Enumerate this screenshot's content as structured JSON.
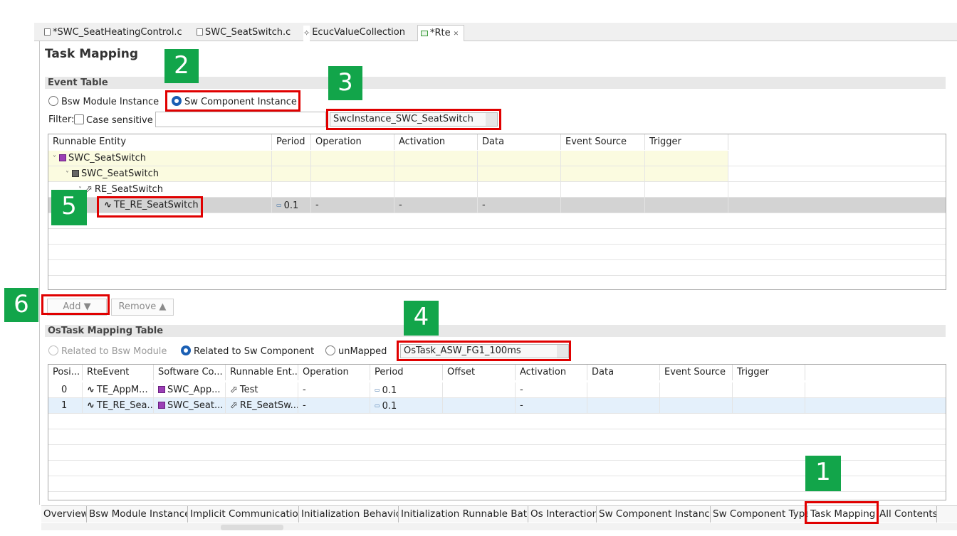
{
  "editor_tabs": [
    {
      "label": "*SWC_SeatHeatingControl.c",
      "icon": "c-file-icon"
    },
    {
      "label": "SWC_SeatSwitch.c",
      "icon": "c-file-icon"
    },
    {
      "label": "EcucValueCollection",
      "icon": "ecuc-icon"
    },
    {
      "label": "*Rte",
      "icon": "rte-icon",
      "close": "✕"
    }
  ],
  "page_title": "Task Mapping",
  "event_table": {
    "header": "Event Table",
    "radio_bsw": "Bsw Module Instance",
    "radio_swc": "Sw Component Instance",
    "filter_label": "Filter:",
    "case_sensitive": "Case sensitive",
    "filter_value": "",
    "instance_combo": "SwcInstance_SWC_SeatSwitch",
    "columns": [
      "Runnable Entity",
      "Period",
      "Operation",
      "Activation",
      "Data",
      "Event Source",
      "Trigger"
    ],
    "tree": {
      "swc": "SWC_SeatSwitch",
      "type": "SWC_SeatSwitch",
      "runnable": "RE_SeatSwitch",
      "event": "TE_RE_SeatSwitch",
      "event_period": "0.1",
      "event_operation": "-",
      "event_activation": "-",
      "event_data": "-"
    }
  },
  "buttons": {
    "add": "Add ▼",
    "remove": "Remove ▲"
  },
  "ostask_table": {
    "header": "OsTask Mapping Table",
    "radio_bsw": "Related to Bsw Module",
    "radio_swc": "Related to Sw Component",
    "radio_unmapped": "unMapped",
    "task_combo": "OsTask_ASW_FG1_100ms",
    "columns": [
      "Posi...",
      "RteEvent",
      "Software Co...",
      "Runnable Ent...",
      "Operation",
      "Period",
      "Offset",
      "Activation",
      "Data",
      "Event Source",
      "Trigger"
    ],
    "rows": [
      {
        "pos": "0",
        "event": "TE_AppM...",
        "swc": "SWC_App...",
        "runnable": "Test",
        "operation": "-",
        "period": "0.1",
        "offset": "",
        "activation": "-"
      },
      {
        "pos": "1",
        "event": "TE_RE_Sea...",
        "swc": "SWC_Seat...",
        "runnable": "RE_SeatSw...",
        "operation": "-",
        "period": "0.1",
        "offset": "",
        "activation": "-"
      }
    ]
  },
  "bottom_tabs": [
    "Overview",
    "Bsw Module Instance",
    "Implicit Communication",
    "Initialization Behavior",
    "Initialization Runnable Batch",
    "Os Interaction",
    "Sw Component Instance",
    "Sw Component Type",
    "Task Mapping",
    "All Contents"
  ],
  "markers": [
    "1",
    "2",
    "3",
    "4",
    "5",
    "6"
  ],
  "colors": {
    "highlight": "#e00000",
    "marker": "#12a54a",
    "swc_icon": "#9b3fb5"
  }
}
